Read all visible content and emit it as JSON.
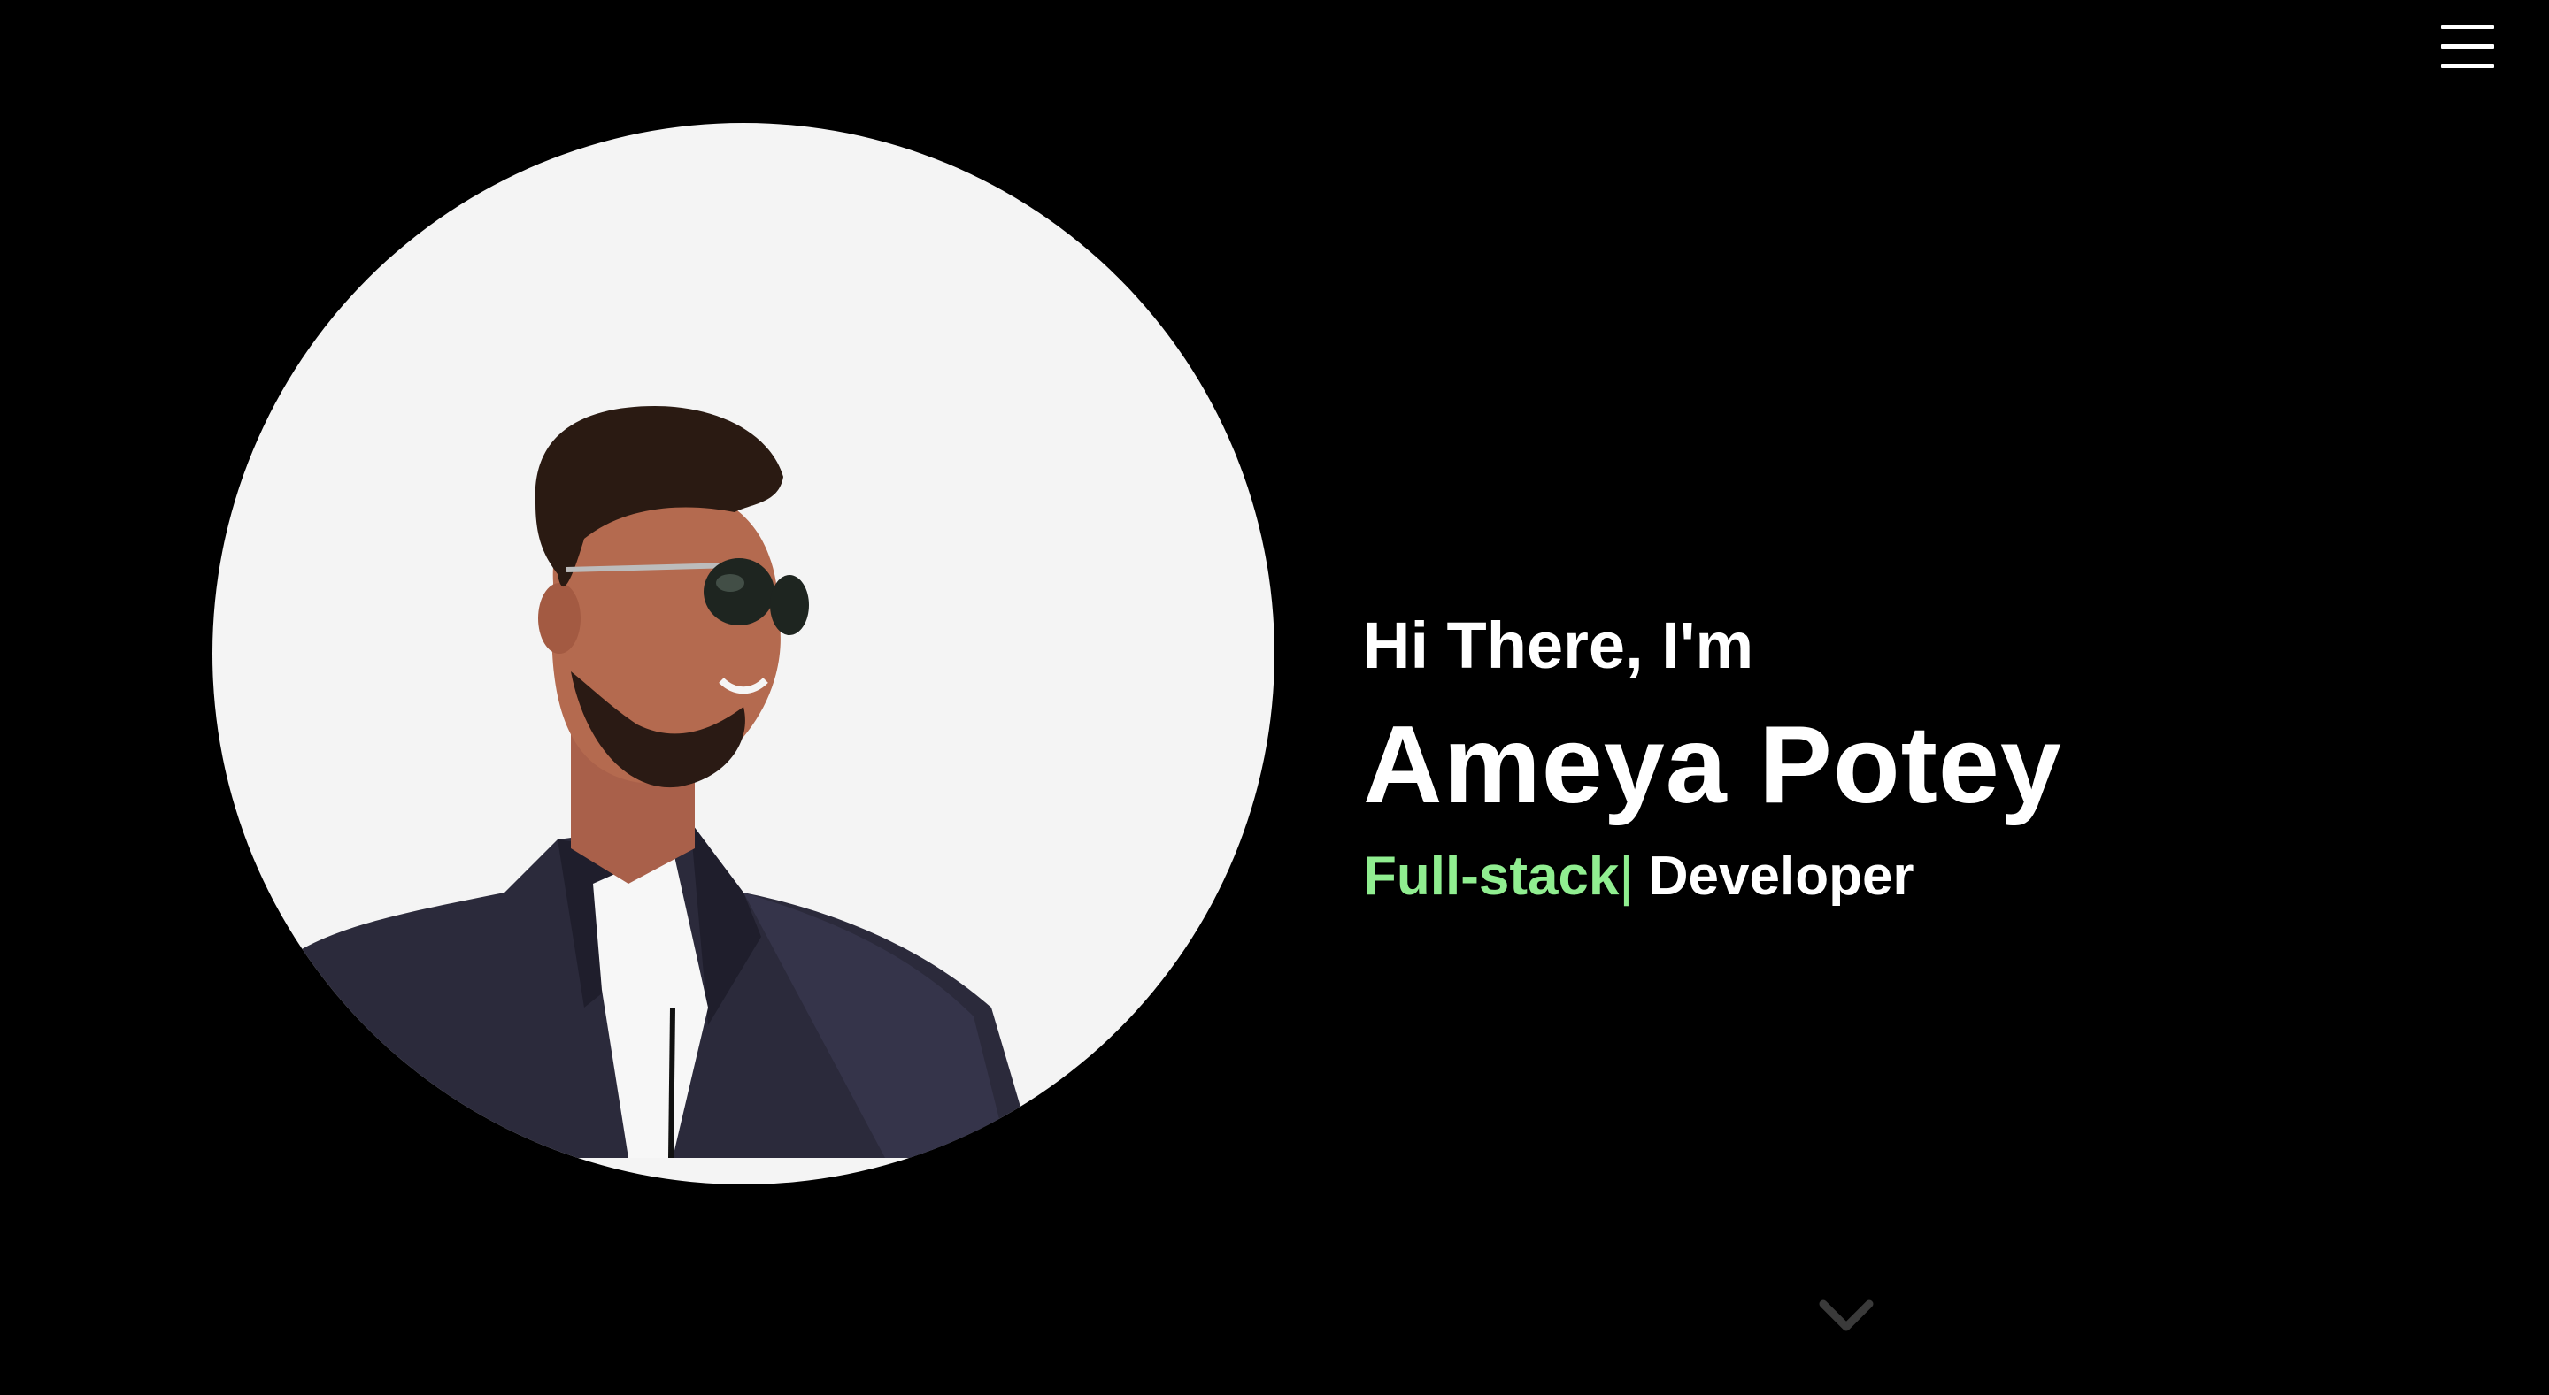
{
  "header": {
    "menu_icon": "hamburger-menu-icon"
  },
  "hero": {
    "greeting": "Hi There, I'm",
    "name": "Ameya Potey",
    "role_typed": "Full-stack",
    "role_cursor": "|",
    "role_rest": " Developer",
    "scroll_icon": "chevron-down-icon"
  },
  "colors": {
    "background": "#000000",
    "text": "#ffffff",
    "accent": "#90ee90",
    "avatar_bg": "#f4f4f4",
    "scroll_icon": "#3a3a3a"
  }
}
